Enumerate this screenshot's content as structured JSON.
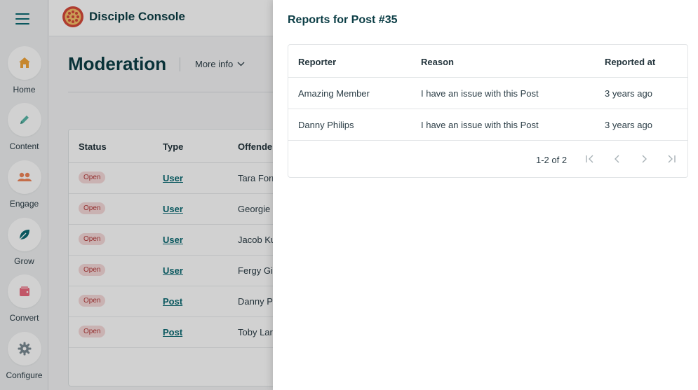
{
  "app": {
    "title": "Disciple Console"
  },
  "rail": {
    "items": [
      {
        "label": "Home",
        "icon": "home-icon"
      },
      {
        "label": "Content",
        "icon": "pencil-icon"
      },
      {
        "label": "Engage",
        "icon": "people-icon"
      },
      {
        "label": "Grow",
        "icon": "leaf-icon"
      },
      {
        "label": "Convert",
        "icon": "wallet-icon"
      },
      {
        "label": "Configure",
        "icon": "gear-icon"
      }
    ]
  },
  "page": {
    "title": "Moderation",
    "more_info": "More info"
  },
  "moderation_table": {
    "columns": [
      "Status",
      "Type",
      "Offender"
    ],
    "rows": [
      {
        "status": "Open",
        "type": "User",
        "offender": "Tara Forr"
      },
      {
        "status": "Open",
        "type": "User",
        "offender": "Georgie"
      },
      {
        "status": "Open",
        "type": "User",
        "offender": "Jacob Ku"
      },
      {
        "status": "Open",
        "type": "User",
        "offender": "Fergy Gi"
      },
      {
        "status": "Open",
        "type": "Post",
        "offender": "Danny P"
      },
      {
        "status": "Open",
        "type": "Post",
        "offender": "Toby Lar"
      }
    ]
  },
  "drawer": {
    "title": "Reports for Post #35",
    "columns": [
      "Reporter",
      "Reason",
      "Reported at"
    ],
    "rows": [
      {
        "reporter": "Amazing Member",
        "reason": "I have an issue with this Post",
        "reported_at": "3 years ago"
      },
      {
        "reporter": "Danny Philips",
        "reason": "I have an issue with this Post",
        "reported_at": "3 years ago"
      }
    ],
    "pagination": "1-2 of 2"
  },
  "colors": {
    "accent": "#0b6b73",
    "brand_text": "#0b3d45",
    "badge_bg": "#f6d9d9",
    "badge_text": "#b33a3a"
  }
}
